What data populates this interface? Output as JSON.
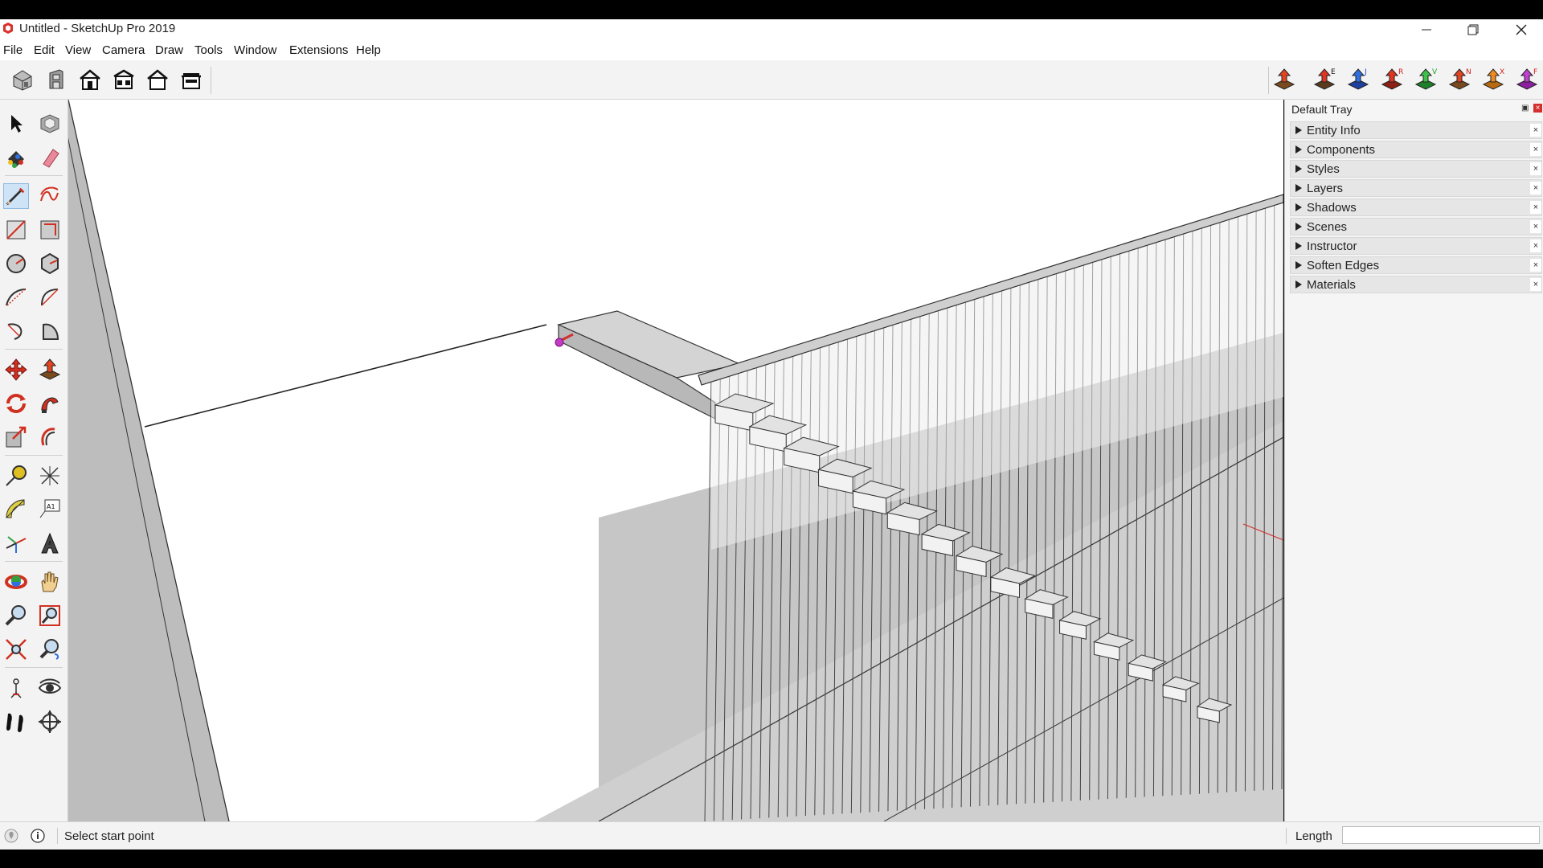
{
  "window": {
    "title": "Untitled - SketchUp Pro 2019",
    "minimize": "minimize",
    "restore": "restore",
    "close": "close"
  },
  "menu": [
    "File",
    "Edit",
    "View",
    "Camera",
    "Draw",
    "Tools",
    "Window",
    "Extensions",
    "Help"
  ],
  "toolbar": {
    "views": [
      "iso-view-icon",
      "front-view-icon",
      "top-view-icon",
      "right-view-icon",
      "back-view-icon",
      "left-view-icon"
    ],
    "push_pull_tools": [
      "push-pull-icon",
      "push-pull-e-icon",
      "push-pull-j-icon",
      "push-pull-r-icon",
      "push-pull-v-icon",
      "push-pull-n-icon",
      "push-pull-x-icon",
      "push-pull-f-icon"
    ],
    "push_pull_letters": [
      "",
      "E",
      "J",
      "R",
      "V",
      "N",
      "X",
      "F"
    ]
  },
  "palette": {
    "selected_tool": "line-tool"
  },
  "tray": {
    "title": "Default Tray",
    "items": [
      "Entity Info",
      "Components",
      "Styles",
      "Layers",
      "Shadows",
      "Scenes",
      "Instructor",
      "Soften Edges",
      "Materials"
    ]
  },
  "status": {
    "message": "Select start point",
    "vcb_label": "Length",
    "vcb_value": ""
  },
  "colors": {
    "selection_highlight": "#cfe3f6",
    "axis_red": "#d32f2f",
    "endpoint_magenta": "#c03cc0",
    "ground_gray": "#c6c6c6"
  }
}
